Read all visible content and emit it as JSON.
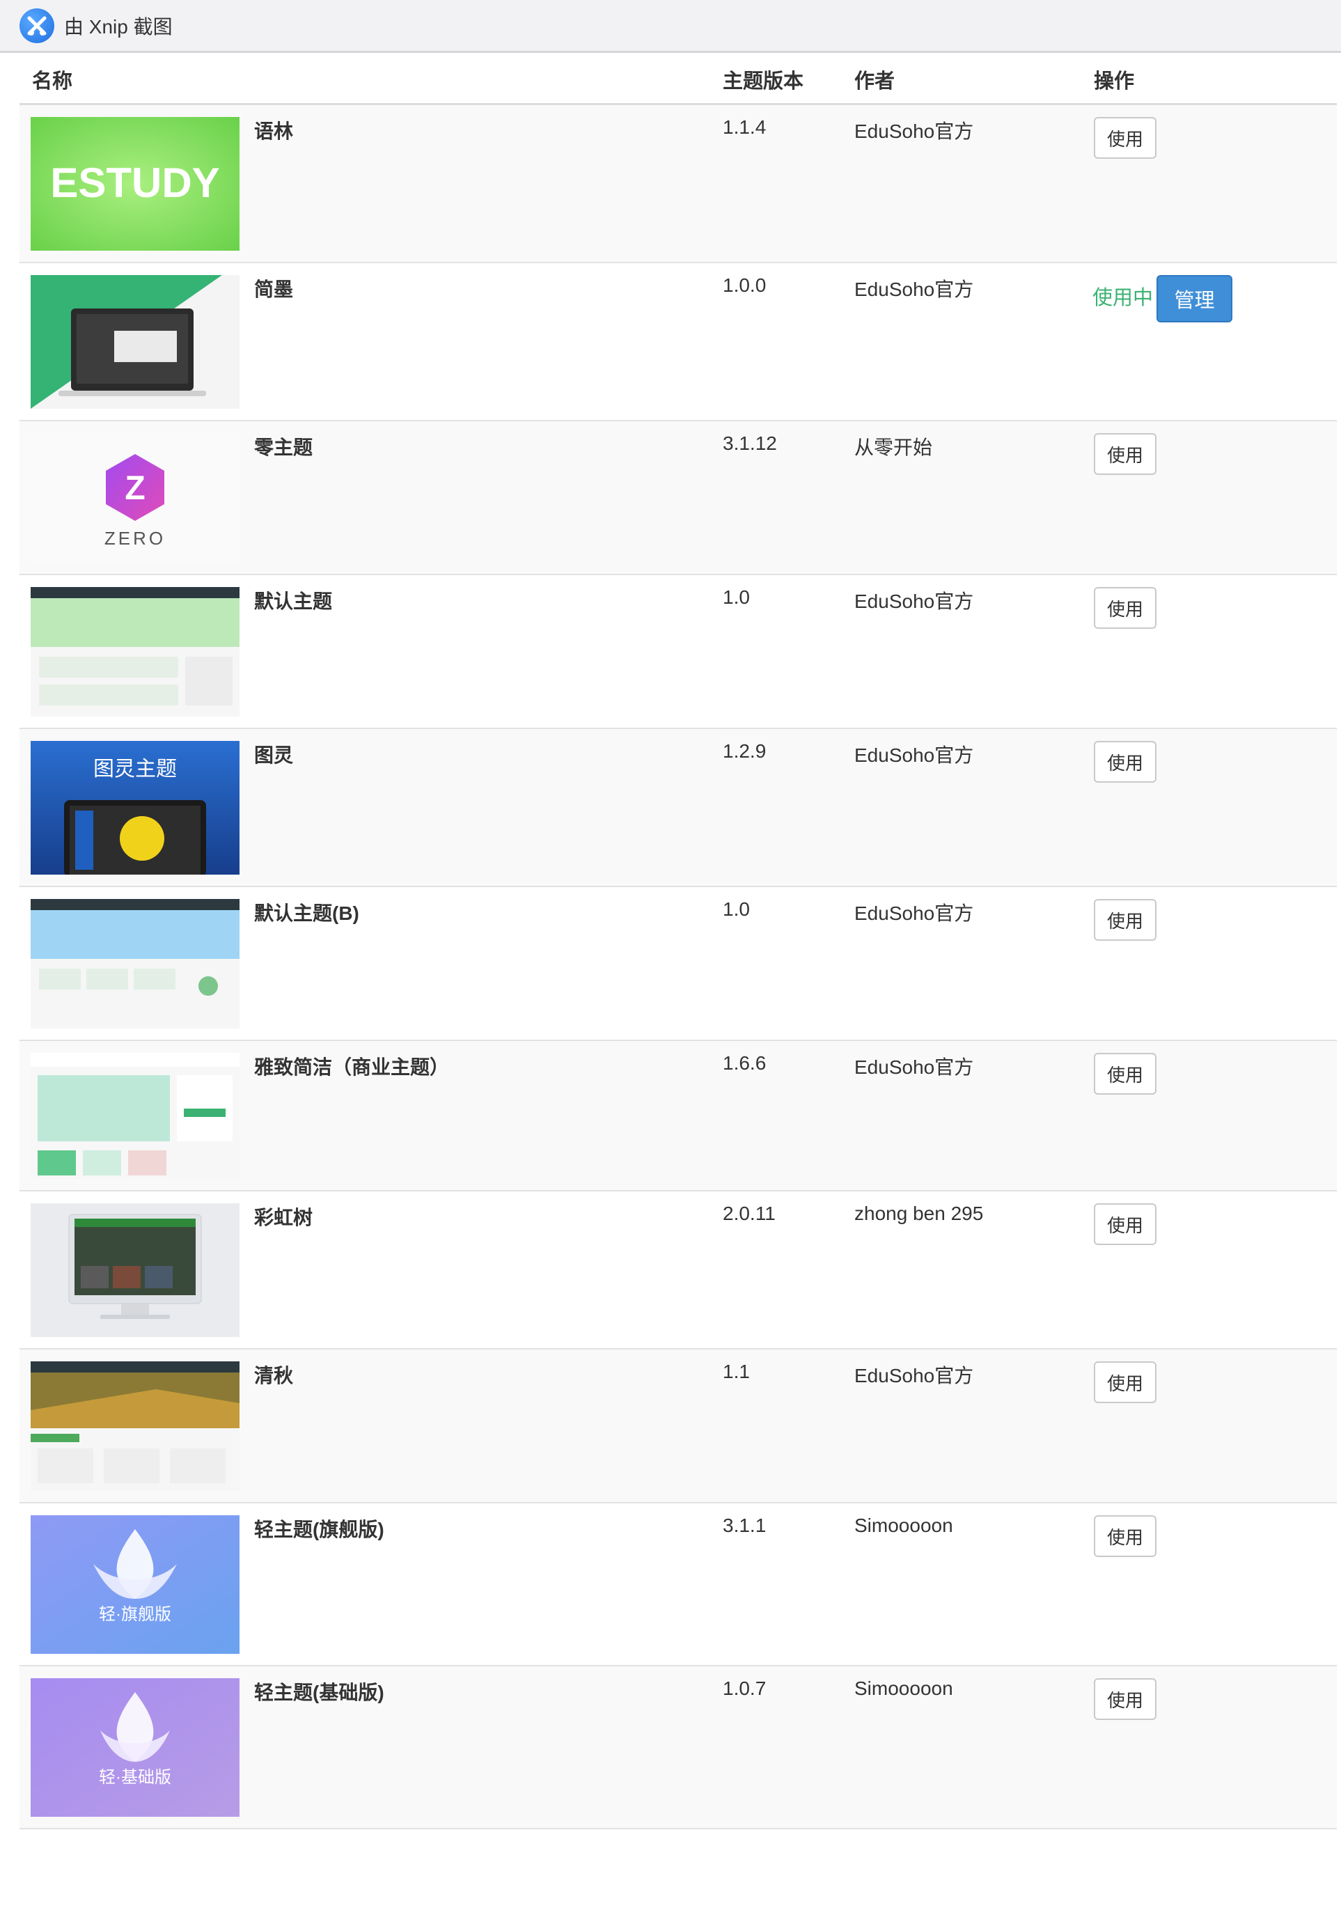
{
  "window": {
    "title": "由 Xnip 截图"
  },
  "table": {
    "headers": {
      "name": "名称",
      "version": "主题版本",
      "author": "作者",
      "action": "操作"
    },
    "rows": [
      {
        "name": "语林",
        "version": "1.1.4",
        "author": "EduSoho官方",
        "action": "使用",
        "thumb_text": "ESTUDY"
      },
      {
        "name": "简墨",
        "version": "1.0.0",
        "author": "EduSoho官方",
        "status": "使用中",
        "manage": "管理"
      },
      {
        "name": "零主题",
        "version": "3.1.12",
        "author": "从零开始",
        "action": "使用",
        "thumb_text": "ZERO"
      },
      {
        "name": "默认主题",
        "version": "1.0",
        "author": "EduSoho官方",
        "action": "使用"
      },
      {
        "name": "图灵",
        "version": "1.2.9",
        "author": "EduSoho官方",
        "action": "使用",
        "thumb_text": "图灵主题"
      },
      {
        "name": "默认主题(B)",
        "version": "1.0",
        "author": "EduSoho官方",
        "action": "使用"
      },
      {
        "name": "雅致简洁（商业主题）",
        "version": "1.6.6",
        "author": "EduSoho官方",
        "action": "使用"
      },
      {
        "name": "彩虹树",
        "version": "2.0.11",
        "author": "zhong ben 295",
        "action": "使用"
      },
      {
        "name": "清秋",
        "version": "1.1",
        "author": "EduSoho官方",
        "action": "使用"
      },
      {
        "name": "轻主题(旗舰版)",
        "version": "3.1.1",
        "author": "Simooooon",
        "action": "使用",
        "thumb_text": "轻·旗舰版"
      },
      {
        "name": "轻主题(基础版)",
        "version": "1.0.7",
        "author": "Simooooon",
        "action": "使用",
        "thumb_text": "轻·基础版"
      }
    ]
  },
  "colors": {
    "in_use": "#3bb273",
    "manage_button": "#3f8fd8",
    "row_stripe": "#f9f9f9"
  }
}
